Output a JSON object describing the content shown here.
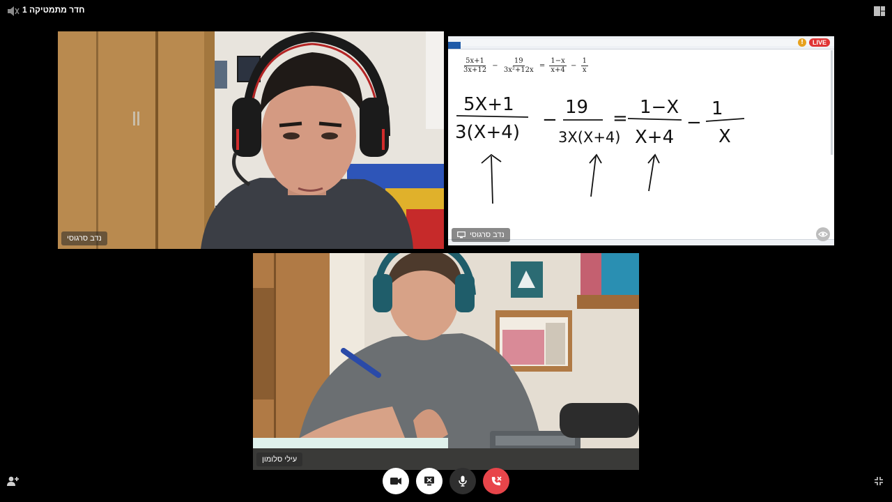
{
  "app": {
    "room_title": "חדר מתמטיקה 1"
  },
  "tiles": [
    {
      "id": "participant-1",
      "name": "נדב סרגוסי",
      "type": "camera"
    },
    {
      "id": "screen-share",
      "name": "נדב סרגוסי",
      "type": "screen-share",
      "live_label": "LIVE"
    },
    {
      "id": "participant-2",
      "name": "עילי סלומון",
      "type": "camera"
    }
  ],
  "whiteboard": {
    "typed_equation": {
      "t1_num": "5x+1",
      "t1_den": "3x+12",
      "op1": "−",
      "t2_num": "19",
      "t2_den": "3x²+12x",
      "op2": "=",
      "t3_num": "1−x",
      "t3_den": "x+4",
      "op3": "−",
      "t4_num": "1",
      "t4_den": "x"
    },
    "handwritten": {
      "t1_num": "5X+1",
      "t1_den": "3(X+4)",
      "op1": "−",
      "t2_num": "19",
      "t2_den": "3X(X+4)",
      "op2": "=",
      "t3_num": "1−X",
      "t3_den": "X+4",
      "op3": "−",
      "t4_num": "1",
      "t4_den": "X"
    },
    "warning_mark": "!"
  },
  "controls": {
    "camera": "video-camera-icon",
    "share": "stop-share-icon",
    "mic": "microphone-icon",
    "end_call": "end-call-icon"
  },
  "colors": {
    "background": "#000000",
    "end_call": "#e8454a",
    "live": "#e03434",
    "ribbon": "#1e5aa8"
  }
}
